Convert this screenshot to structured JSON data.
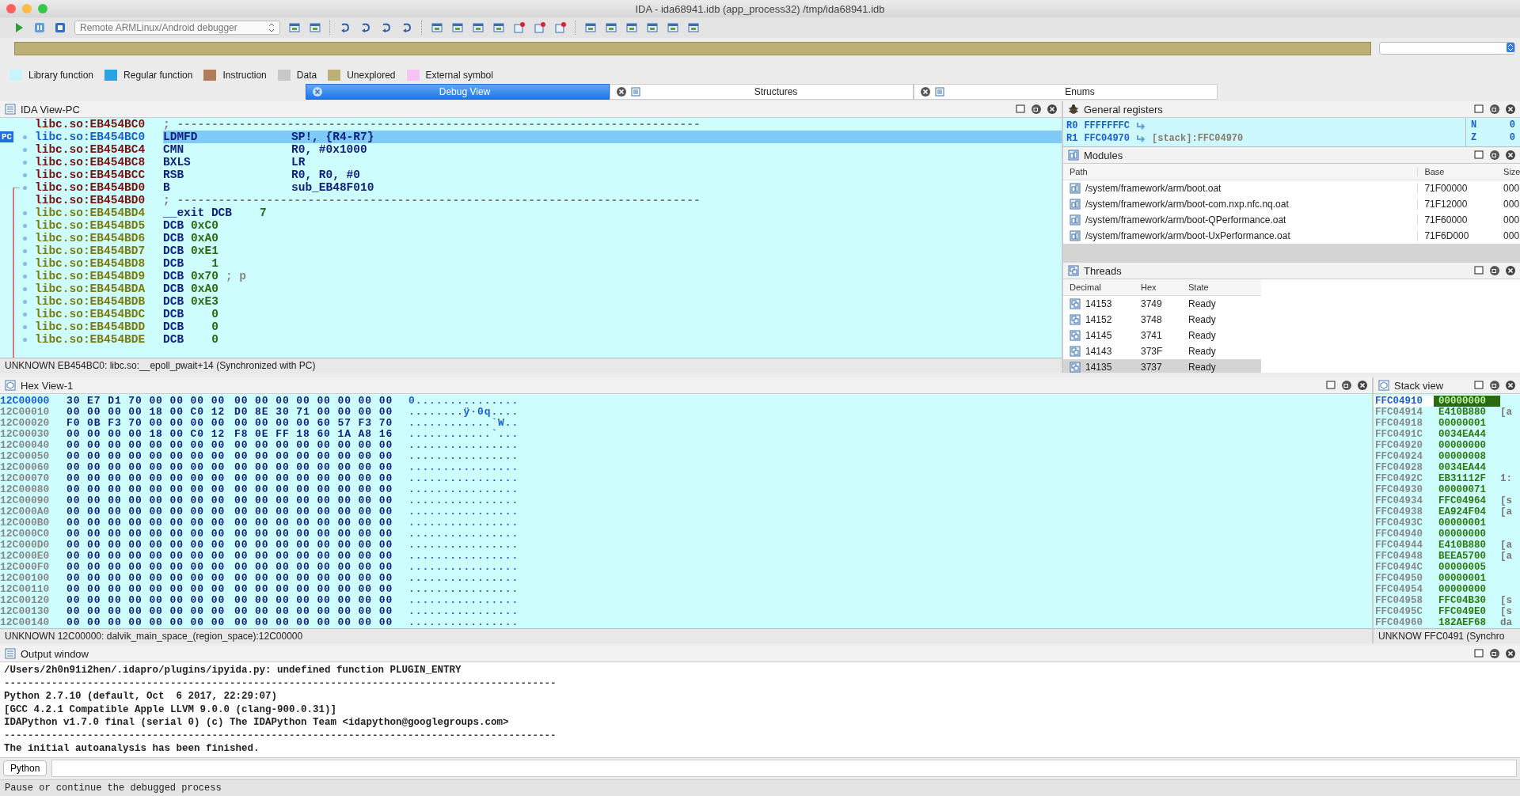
{
  "window": {
    "title": "IDA - ida68941.idb (app_process32) /tmp/ida68941.idb"
  },
  "toolbar": {
    "debugger": "Remote ARMLinux/Android debugger"
  },
  "legend": [
    {
      "label": "Library function",
      "color": "#c8f4fc"
    },
    {
      "label": "Regular function",
      "color": "#2aa3e0"
    },
    {
      "label": "Instruction",
      "color": "#b07c5c"
    },
    {
      "label": "Data",
      "color": "#c8c8c8"
    },
    {
      "label": "Unexplored",
      "color": "#bdb076"
    },
    {
      "label": "External symbol",
      "color": "#f5c4f5"
    }
  ],
  "tabs": [
    {
      "label": "Debug View",
      "selected": true
    },
    {
      "label": "Structures",
      "selected": false
    },
    {
      "label": "Enums",
      "selected": false
    }
  ],
  "ida_view": {
    "title": "IDA View-PC",
    "pc_marker": "PC",
    "lines": [
      {
        "kind": "separator",
        "address": "libc.so:EB454BC0",
        "text": "; ----------------------------------------------------------------------------",
        "selected": false
      },
      {
        "kind": "code",
        "address": "libc.so:EB454BC0",
        "mnemonic": "LDMFD",
        "operands": "SP!, {R4-R7}",
        "selected": true
      },
      {
        "kind": "code",
        "address": "libc.so:EB454BC4",
        "mnemonic": "CMN",
        "operands": "R0, #0x1000",
        "selected": false
      },
      {
        "kind": "code",
        "address": "libc.so:EB454BC8",
        "mnemonic": "BXLS",
        "operands": "LR",
        "selected": false
      },
      {
        "kind": "code",
        "address": "libc.so:EB454BCC",
        "mnemonic": "RSB",
        "operands": "R0, R0, #0",
        "selected": false
      },
      {
        "kind": "code",
        "address": "libc.so:EB454BD0",
        "mnemonic": "B",
        "operands": "sub_EB48F010",
        "selected": false
      },
      {
        "kind": "separator",
        "address": "libc.so:EB454BD0",
        "text": "; ----------------------------------------------------------------------------",
        "selected": false
      },
      {
        "kind": "data",
        "address": "libc.so:EB454BD4",
        "mnemonic": "__exit DCB",
        "operands": "7",
        "selected": false
      },
      {
        "kind": "data",
        "address": "libc.so:EB454BD5",
        "mnemonic": "DCB",
        "operands": "0xC0",
        "selected": false
      },
      {
        "kind": "data",
        "address": "libc.so:EB454BD6",
        "mnemonic": "DCB",
        "operands": "0xA0",
        "selected": false
      },
      {
        "kind": "data",
        "address": "libc.so:EB454BD7",
        "mnemonic": "DCB",
        "operands": "0xE1",
        "selected": false
      },
      {
        "kind": "data",
        "address": "libc.so:EB454BD8",
        "mnemonic": "DCB",
        "operands": "1",
        "selected": false
      },
      {
        "kind": "data",
        "address": "libc.so:EB454BD9",
        "mnemonic": "DCB",
        "operands": "0x70",
        "comment": "; p",
        "selected": false
      },
      {
        "kind": "data",
        "address": "libc.so:EB454BDA",
        "mnemonic": "DCB",
        "operands": "0xA0",
        "selected": false
      },
      {
        "kind": "data",
        "address": "libc.so:EB454BDB",
        "mnemonic": "DCB",
        "operands": "0xE3",
        "selected": false
      },
      {
        "kind": "data",
        "address": "libc.so:EB454BDC",
        "mnemonic": "DCB",
        "operands": "0",
        "selected": false
      },
      {
        "kind": "data",
        "address": "libc.so:EB454BDD",
        "mnemonic": "DCB",
        "operands": "0",
        "selected": false
      },
      {
        "kind": "data",
        "address": "libc.so:EB454BDE",
        "mnemonic": "DCB",
        "operands": "0",
        "selected": false
      }
    ],
    "status": "UNKNOWN  EB454BC0: libc.so:__epoll_pwait+14  (Synchronized with PC)"
  },
  "registers": {
    "title": "General registers",
    "rows": [
      {
        "name": "R0",
        "value": "FFFFFFFC"
      },
      {
        "name": "R1",
        "value": "FFC04970",
        "target": "[stack]:FFC04970"
      }
    ],
    "flags": [
      {
        "name": "N",
        "value": "0"
      },
      {
        "name": "Z",
        "value": "0"
      }
    ]
  },
  "modules": {
    "title": "Modules",
    "columns": [
      "Path",
      "Base",
      "Size"
    ],
    "rows": [
      {
        "path": "/system/framework/arm/boot.oat",
        "base": "71F00000",
        "size": "000"
      },
      {
        "path": "/system/framework/arm/boot-com.nxp.nfc.nq.oat",
        "base": "71F12000",
        "size": "000"
      },
      {
        "path": "/system/framework/arm/boot-QPerformance.oat",
        "base": "71F60000",
        "size": "000"
      },
      {
        "path": "/system/framework/arm/boot-UxPerformance.oat",
        "base": "71F6D000",
        "size": "000"
      }
    ]
  },
  "threads": {
    "title": "Threads",
    "columns": [
      "Decimal",
      "Hex",
      "State"
    ],
    "rows": [
      {
        "decimal": "14153",
        "hex": "3749",
        "state": "Ready",
        "selected": false
      },
      {
        "decimal": "14152",
        "hex": "3748",
        "state": "Ready",
        "selected": false
      },
      {
        "decimal": "14145",
        "hex": "3741",
        "state": "Ready",
        "selected": false
      },
      {
        "decimal": "14143",
        "hex": "373F",
        "state": "Ready",
        "selected": false
      },
      {
        "decimal": "14135",
        "hex": "3737",
        "state": "Ready",
        "selected": true
      }
    ]
  },
  "hex_view": {
    "title": "Hex View-1",
    "rows": [
      {
        "address": "12C00000",
        "left": "30 E7 D1 70 00 00 00 00",
        "right": "00 00 00 00 00 00 00 00",
        "ascii": "0...............",
        "selected": true
      },
      {
        "address": "12C00010",
        "left": "00 00 00 00 18 00 C0 12",
        "right": "D0 8E 30 71 00 00 00 00",
        "ascii": "........ÿ·0q....",
        "selected": false
      },
      {
        "address": "12C00020",
        "left": "F0 0B F3 70 00 00 00 00",
        "right": "00 00 00 00 60 57 F3 70",
        "ascii": "............`W..",
        "selected": false
      },
      {
        "address": "12C00030",
        "left": "00 00 00 00 18 00 C0 12",
        "right": "F8 0E FF 18 60 1A A8 16",
        "ascii": "............`...",
        "selected": false
      },
      {
        "address": "12C00040",
        "left": "00 00 00 00 00 00 00 00",
        "right": "00 00 00 00 00 00 00 00",
        "ascii": "................",
        "selected": false
      },
      {
        "address": "12C00050",
        "left": "00 00 00 00 00 00 00 00",
        "right": "00 00 00 00 00 00 00 00",
        "ascii": "................",
        "selected": false
      },
      {
        "address": "12C00060",
        "left": "00 00 00 00 00 00 00 00",
        "right": "00 00 00 00 00 00 00 00",
        "ascii": "................",
        "selected": false
      },
      {
        "address": "12C00070",
        "left": "00 00 00 00 00 00 00 00",
        "right": "00 00 00 00 00 00 00 00",
        "ascii": "................",
        "selected": false
      },
      {
        "address": "12C00080",
        "left": "00 00 00 00 00 00 00 00",
        "right": "00 00 00 00 00 00 00 00",
        "ascii": "................",
        "selected": false
      },
      {
        "address": "12C00090",
        "left": "00 00 00 00 00 00 00 00",
        "right": "00 00 00 00 00 00 00 00",
        "ascii": "................",
        "selected": false
      },
      {
        "address": "12C000A0",
        "left": "00 00 00 00 00 00 00 00",
        "right": "00 00 00 00 00 00 00 00",
        "ascii": "................",
        "selected": false
      },
      {
        "address": "12C000B0",
        "left": "00 00 00 00 00 00 00 00",
        "right": "00 00 00 00 00 00 00 00",
        "ascii": "................",
        "selected": false
      },
      {
        "address": "12C000C0",
        "left": "00 00 00 00 00 00 00 00",
        "right": "00 00 00 00 00 00 00 00",
        "ascii": "................",
        "selected": false
      },
      {
        "address": "12C000D0",
        "left": "00 00 00 00 00 00 00 00",
        "right": "00 00 00 00 00 00 00 00",
        "ascii": "................",
        "selected": false
      },
      {
        "address": "12C000E0",
        "left": "00 00 00 00 00 00 00 00",
        "right": "00 00 00 00 00 00 00 00",
        "ascii": "................",
        "selected": false
      },
      {
        "address": "12C000F0",
        "left": "00 00 00 00 00 00 00 00",
        "right": "00 00 00 00 00 00 00 00",
        "ascii": "................",
        "selected": false
      },
      {
        "address": "12C00100",
        "left": "00 00 00 00 00 00 00 00",
        "right": "00 00 00 00 00 00 00 00",
        "ascii": "................",
        "selected": false
      },
      {
        "address": "12C00110",
        "left": "00 00 00 00 00 00 00 00",
        "right": "00 00 00 00 00 00 00 00",
        "ascii": "................",
        "selected": false
      },
      {
        "address": "12C00120",
        "left": "00 00 00 00 00 00 00 00",
        "right": "00 00 00 00 00 00 00 00",
        "ascii": "................",
        "selected": false
      },
      {
        "address": "12C00130",
        "left": "00 00 00 00 00 00 00 00",
        "right": "00 00 00 00 00 00 00 00",
        "ascii": "................",
        "selected": false
      },
      {
        "address": "12C00140",
        "left": "00 00 00 00 00 00 00 00",
        "right": "00 00 00 00 00 00 00 00",
        "ascii": "................",
        "selected": false
      }
    ],
    "status": "UNKNOWN  12C00000: dalvik_main_space_(region_space):12C00000"
  },
  "stack_view": {
    "title": "Stack view",
    "rows": [
      {
        "address": "FFC04910",
        "value": "00000000",
        "selected": true
      },
      {
        "address": "FFC04914",
        "value": "E410B880",
        "comment": "[a",
        "selected": false
      },
      {
        "address": "FFC04918",
        "value": "00000001",
        "selected": false
      },
      {
        "address": "FFC0491C",
        "value": "0034EA44",
        "selected": false
      },
      {
        "address": "FFC04920",
        "value": "00000000",
        "selected": false
      },
      {
        "address": "FFC04924",
        "value": "00000008",
        "selected": false
      },
      {
        "address": "FFC04928",
        "value": "0034EA44",
        "selected": false
      },
      {
        "address": "FFC0492C",
        "value": "EB31112F",
        "comment": "1:",
        "selected": false
      },
      {
        "address": "FFC04930",
        "value": "00000071",
        "selected": false
      },
      {
        "address": "FFC04934",
        "value": "FFC04964",
        "comment": "[s",
        "selected": false
      },
      {
        "address": "FFC04938",
        "value": "EA924F04",
        "comment": "[a",
        "selected": false
      },
      {
        "address": "FFC0493C",
        "value": "00000001",
        "selected": false
      },
      {
        "address": "FFC04940",
        "value": "00000000",
        "selected": false
      },
      {
        "address": "FFC04944",
        "value": "E410B880",
        "comment": "[a",
        "selected": false
      },
      {
        "address": "FFC04948",
        "value": "BEEA5700",
        "comment": "[a",
        "selected": false
      },
      {
        "address": "FFC0494C",
        "value": "00000005",
        "selected": false
      },
      {
        "address": "FFC04950",
        "value": "00000001",
        "selected": false
      },
      {
        "address": "FFC04954",
        "value": "00000000",
        "selected": false
      },
      {
        "address": "FFC04958",
        "value": "FFC04B30",
        "comment": "[s",
        "selected": false
      },
      {
        "address": "FFC0495C",
        "value": "FFC049E0",
        "comment": "[s",
        "selected": false
      },
      {
        "address": "FFC04960",
        "value": "182AEF68",
        "comment": "da",
        "selected": false
      }
    ],
    "status": "UNKNOW FFC0491 (Synchro"
  },
  "output": {
    "title": "Output window",
    "lines": [
      {
        "kind": "text",
        "text": "/Users/2h0n91i2hen/.idapro/plugins/ipyida.py: undefined function PLUGIN_ENTRY"
      },
      {
        "kind": "rule",
        "text": "---------------------------------------------------------------------------------------------"
      },
      {
        "kind": "text",
        "text": "Python 2.7.10 (default, Oct  6 2017, 22:29:07)"
      },
      {
        "kind": "text",
        "text": "[GCC 4.2.1 Compatible Apple LLVM 9.0.0 (clang-900.0.31)]"
      },
      {
        "kind": "text",
        "text": "IDAPython v1.7.0 final (serial 0) (c) The IDAPython Team <idapython@googlegroups.com>"
      },
      {
        "kind": "rule",
        "text": "---------------------------------------------------------------------------------------------"
      },
      {
        "kind": "text",
        "text": "The initial autoanalysis has been finished."
      }
    ],
    "language_button": "Python"
  },
  "status_bar": "Pause or continue the debugged process"
}
